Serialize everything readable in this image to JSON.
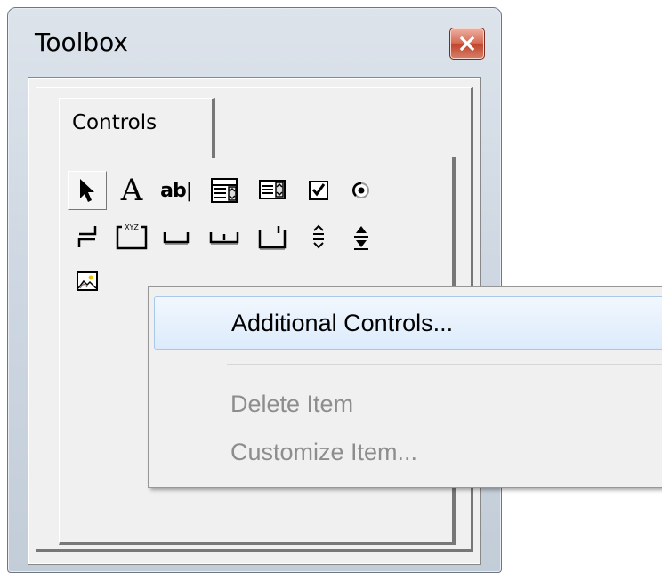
{
  "window": {
    "title": "Toolbox"
  },
  "tabs": [
    {
      "label": "Controls",
      "active": true
    }
  ],
  "tools": [
    {
      "name": "select-objects-icon"
    },
    {
      "name": "label-icon",
      "glyph": "A"
    },
    {
      "name": "textbox-icon",
      "glyph": "ab|"
    },
    {
      "name": "combobox-icon"
    },
    {
      "name": "listbox-icon"
    },
    {
      "name": "checkbox-icon"
    },
    {
      "name": "optionbutton-icon"
    },
    {
      "name": "togglebutton-icon"
    },
    {
      "name": "frame-icon",
      "glyph": "XYZ"
    },
    {
      "name": "commandbutton-icon"
    },
    {
      "name": "tabstrip-icon"
    },
    {
      "name": "multipage-icon"
    },
    {
      "name": "scrollbar-icon"
    },
    {
      "name": "spinbutton-icon"
    },
    {
      "name": "image-icon"
    }
  ],
  "context_menu": {
    "items": [
      {
        "label": "Additional Controls...",
        "state": "highlighted"
      },
      {
        "label": "Delete Item",
        "state": "disabled"
      },
      {
        "label": "Customize Item...",
        "state": "disabled"
      }
    ]
  },
  "colors": {
    "menu_highlight": "#dcebfc",
    "disabled_text": "#8d8d8d",
    "close_button": "#c0442b"
  }
}
